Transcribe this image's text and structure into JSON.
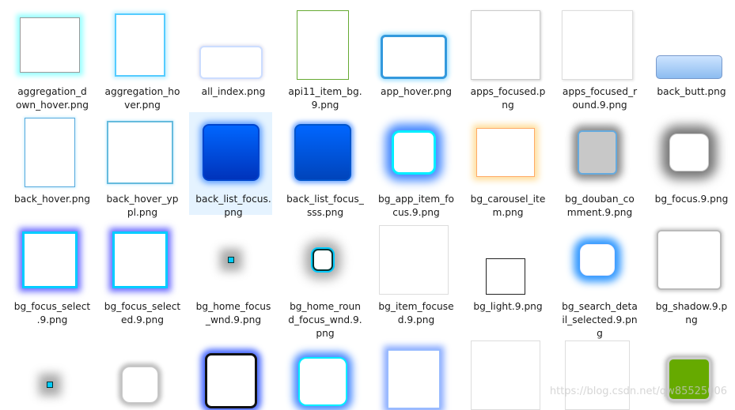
{
  "tiles": [
    {
      "label": "aggregation_d\nown_hover.png",
      "icon": "image-thumbnail-icon"
    },
    {
      "label": "aggregation_ho\nver.png",
      "icon": "image-thumbnail-icon"
    },
    {
      "label": "all_index.png",
      "icon": "image-thumbnail-icon"
    },
    {
      "label": "api11_item_bg.\n9.png",
      "icon": "image-thumbnail-icon"
    },
    {
      "label": "app_hover.png",
      "icon": "image-thumbnail-icon"
    },
    {
      "label": "apps_focused.p\nng",
      "icon": "image-thumbnail-icon"
    },
    {
      "label": "apps_focused_r\nound.9.png",
      "icon": "image-thumbnail-icon"
    },
    {
      "label": "back_butt.png",
      "icon": "image-thumbnail-icon"
    },
    {
      "label": "back_hover.png",
      "icon": "image-thumbnail-icon"
    },
    {
      "label": "back_hover_yp\npl.png",
      "icon": "image-thumbnail-icon"
    },
    {
      "label": "back_list_focus.\npng",
      "icon": "image-thumbnail-icon"
    },
    {
      "label": "back_list_focus_\nsss.png",
      "icon": "image-thumbnail-icon"
    },
    {
      "label": "bg_app_item_fo\ncus.9.png",
      "icon": "image-thumbnail-icon"
    },
    {
      "label": "bg_carousel_ite\nm.png",
      "icon": "image-thumbnail-icon"
    },
    {
      "label": "bg_douban_co\nmment.9.png",
      "icon": "image-thumbnail-icon"
    },
    {
      "label": "bg_focus.9.png",
      "icon": "image-thumbnail-icon"
    },
    {
      "label": "bg_focus_select\n.9.png",
      "icon": "image-thumbnail-icon"
    },
    {
      "label": "bg_focus_select\ned.9.png",
      "icon": "image-thumbnail-icon"
    },
    {
      "label": "bg_home_focus\n_wnd.9.png",
      "icon": "image-thumbnail-icon"
    },
    {
      "label": "bg_home_roun\nd_focus_wnd.9.\npng",
      "icon": "image-thumbnail-icon"
    },
    {
      "label": "bg_item_focuse\nd.9.png",
      "icon": "image-thumbnail-icon"
    },
    {
      "label": "bg_light.9.png",
      "icon": "image-thumbnail-icon"
    },
    {
      "label": "bg_search_deta\nil_selected.9.pn\ng",
      "icon": "image-thumbnail-icon"
    },
    {
      "label": "bg_shadow.9.p\nng",
      "icon": "image-thumbnail-icon"
    },
    {
      "label": "",
      "icon": "image-thumbnail-icon"
    },
    {
      "label": "",
      "icon": "image-thumbnail-icon"
    },
    {
      "label": "",
      "icon": "image-thumbnail-icon"
    },
    {
      "label": "",
      "icon": "image-thumbnail-icon"
    },
    {
      "label": "",
      "icon": "image-thumbnail-icon"
    },
    {
      "label": "",
      "icon": "image-thumbnail-icon"
    },
    {
      "label": "",
      "icon": "image-thumbnail-icon"
    },
    {
      "label": "",
      "icon": "image-thumbnail-icon"
    }
  ],
  "selected_index": 10,
  "watermark": "https://blog.csdn.net/qw85525006"
}
